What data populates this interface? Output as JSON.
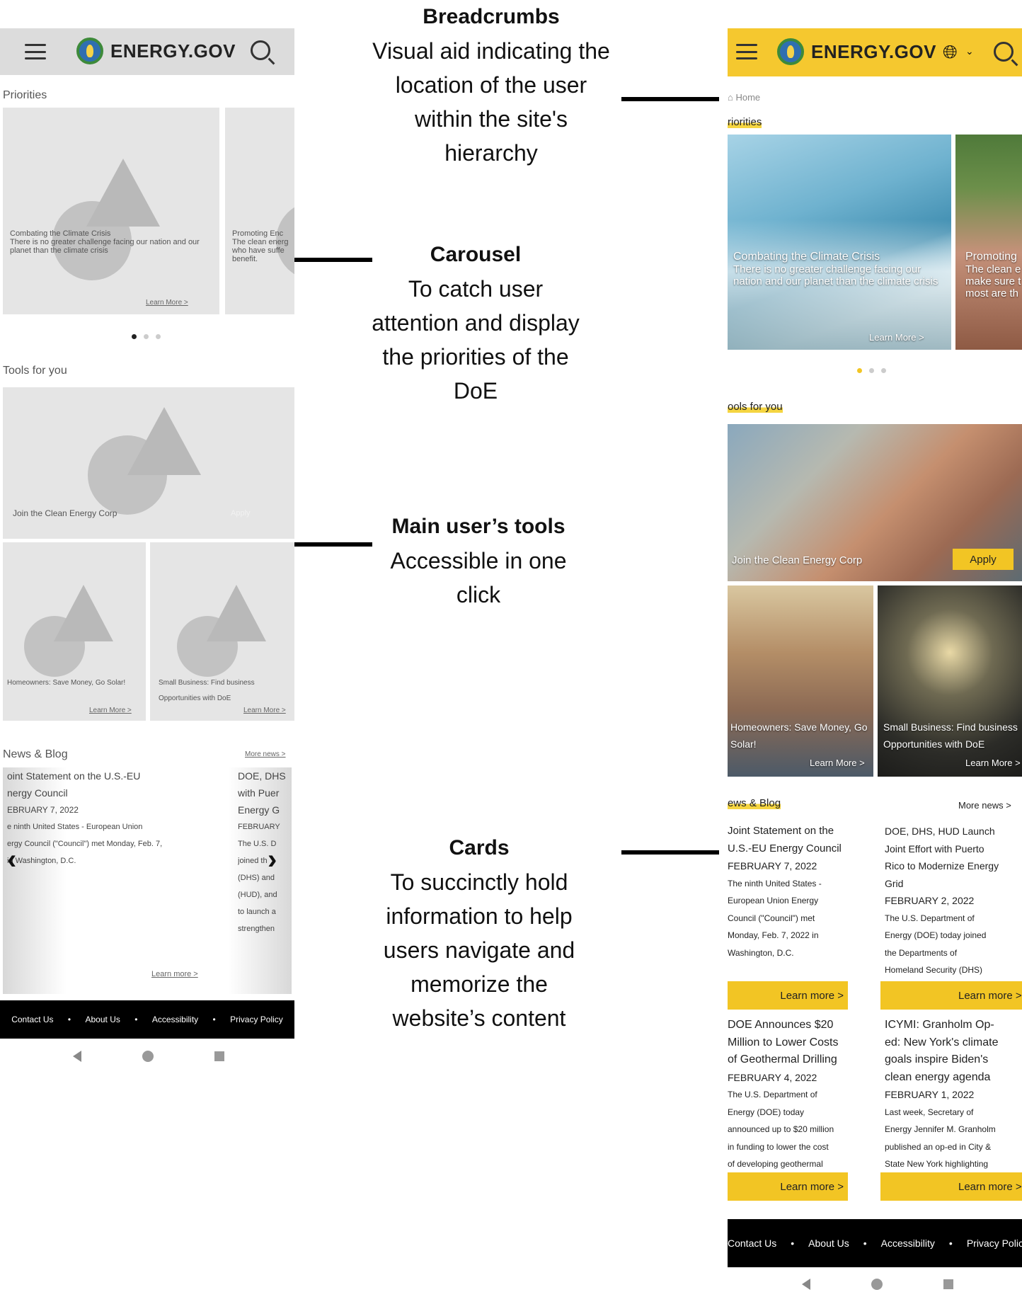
{
  "brand": {
    "name": "ENERGY.GOV"
  },
  "annotations": {
    "breadcrumbs": {
      "title": "Breadcrumbs",
      "lines": [
        "Visual aid indicating the",
        "location of the user",
        "within the site's",
        "hierarchy"
      ]
    },
    "carousel": {
      "title": "Carousel",
      "lines": [
        "To catch user",
        "attention and display",
        "the priorities of the",
        "DoE"
      ]
    },
    "tools": {
      "title": "Main user’s tools",
      "lines": [
        "Accessible in one",
        "click"
      ]
    },
    "cards": {
      "title": "Cards",
      "lines": [
        "To succinctly hold",
        "information to help",
        "users navigate and",
        "memorize the",
        "website’s content"
      ]
    }
  },
  "wireframe": {
    "priorities_label": "Priorities",
    "carousel": [
      {
        "title": "Combating the Climate Crisis",
        "text": "There is no greater challenge facing our nation and our planet than the climate crisis",
        "link": "Learn More >"
      },
      {
        "title": "Promoting Enc",
        "text": "The clean energ who have suffe benefit."
      }
    ],
    "tools_label": "Tools for you",
    "tool_main": {
      "title": "Join the Clean Energy Corp",
      "action": "Apply"
    },
    "tool_a": {
      "title": "Homeowners: Save Money, Go Solar!",
      "link": "Learn More >"
    },
    "tool_b": {
      "title": "Small Business: Find business Opportunities with DoE",
      "link": "Learn More >"
    },
    "news_label": "News & Blog",
    "more_news": "More news >",
    "news1": [
      "oint Statement on the U.S.-EU",
      "nergy Council",
      "EBRUARY 7, 2022",
      "e ninth United States - European Union",
      "ergy Council (\"Council\") met Monday, Feb. 7,",
      "in Washington, D.C."
    ],
    "news2": [
      "DOE, DHS",
      "with Puer",
      "Energy G",
      "FEBRUARY",
      "The U.S. D",
      "joined th",
      "(DHS) and",
      "(HUD), and",
      "to launch a",
      "strengthen"
    ],
    "learn_more": "Learn more >",
    "footer": [
      "Contact Us",
      "About Us",
      "Accessibility",
      "Privacy Policy"
    ]
  },
  "mockup": {
    "breadcrumb": "Home",
    "priorities_label": "riorities",
    "carousel": [
      {
        "title": "Combating the Climate Crisis",
        "text": "There is no greater challenge facing our nation and our planet than the climate crisis",
        "link": "Learn More >"
      },
      {
        "title": "Promoting",
        "text": "The clean e make sure t most are th"
      }
    ],
    "tools_label": "ools for you",
    "tool_main": {
      "title": "Join the Clean Energy Corp",
      "action": "Apply"
    },
    "tool_a": {
      "title": "Homeowners: Save Money, Go Solar!",
      "link": "Learn More >"
    },
    "tool_b": {
      "title": "Small Business: Find business Opportunities with DoE",
      "link": "Learn More >"
    },
    "news_label": "ews & Blog",
    "more_news": "More news >",
    "news": [
      {
        "lines": [
          "Joint Statement on the",
          "U.S.-EU Energy Council",
          "FEBRUARY 7, 2022",
          "The ninth United States -",
          "European Union Energy",
          "Council (\"Council\") met",
          "Monday, Feb. 7, 2022 in",
          "Washington, D.C."
        ],
        "button": "Learn more >"
      },
      {
        "lines": [
          "DOE, DHS, HUD Launch",
          "Joint Effort with Puerto",
          "Rico to Modernize Energy",
          "Grid",
          "FEBRUARY 2, 2022",
          "The U.S. Department of",
          "Energy (DOE) today joined",
          "the Departments of",
          "Homeland Security (DHS)"
        ],
        "button": "Learn more >"
      },
      {
        "lines": [
          "DOE Announces $20",
          "Million to Lower Costs",
          "of Geothermal Drilling",
          "FEBRUARY 4, 2022",
          "The U.S. Department of",
          "Energy (DOE) today",
          "announced up to $20 million",
          "in funding to lower the cost",
          "of developing geothermal"
        ],
        "button": "Learn more >"
      },
      {
        "lines": [
          "ICYMI: Granholm Op-",
          "ed: New York's climate",
          "goals inspire Biden's",
          "clean energy agenda",
          "FEBRUARY 1, 2022",
          "Last week, Secretary of",
          "Energy Jennifer M. Granholm",
          "published an op-ed in City &",
          "State New York highlighting"
        ],
        "button": "Learn more >"
      }
    ],
    "footer": [
      "Contact Us",
      "About Us",
      "Accessibility",
      "Privacy Polic"
    ]
  }
}
